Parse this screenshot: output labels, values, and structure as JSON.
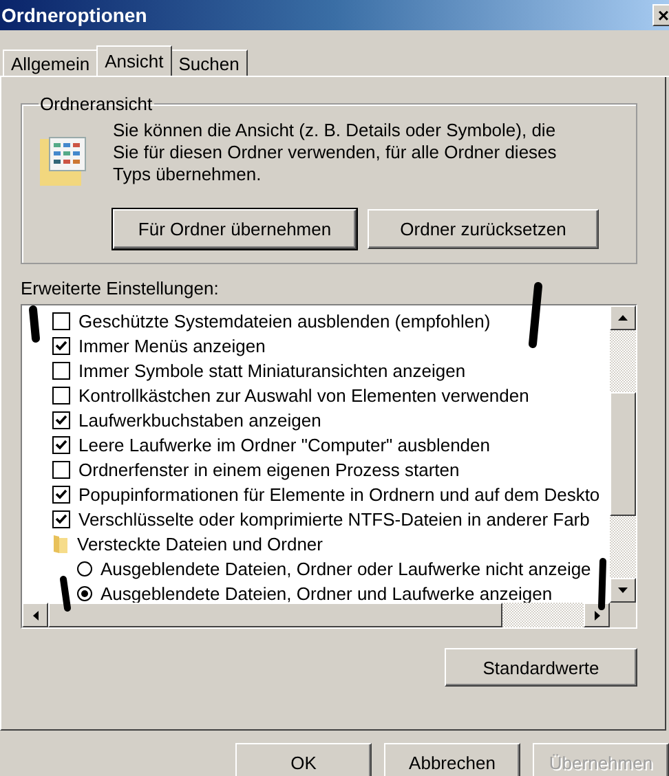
{
  "window": {
    "title": "Ordneroptionen",
    "close": "×"
  },
  "tabs": [
    {
      "label": "Allgemein",
      "selected": false
    },
    {
      "label": "Ansicht",
      "selected": true
    },
    {
      "label": "Suchen",
      "selected": false
    }
  ],
  "folder_view": {
    "title": "Ordneransicht",
    "description": "Sie können die Ansicht (z. B. Details oder Symbole), die Sie für diesen Ordner verwenden, für alle Ordner dieses Typs übernehmen.",
    "buttons": [
      {
        "label": "Für Ordner übernehmen",
        "default": true
      },
      {
        "label": "Ordner zurücksetzen",
        "default": false
      }
    ]
  },
  "advanced": {
    "label": "Erweiterte Einstellungen:",
    "items": [
      {
        "kind": "checkbox",
        "label": "Geschützte Systemdateien ausblenden (empfohlen)",
        "checked": false
      },
      {
        "kind": "checkbox",
        "label": "Immer Menüs anzeigen",
        "checked": true
      },
      {
        "kind": "checkbox",
        "label": "Immer Symbole statt Miniaturansichten anzeigen",
        "checked": false
      },
      {
        "kind": "checkbox",
        "label": "Kontrollkästchen zur Auswahl von Elementen verwenden",
        "checked": false
      },
      {
        "kind": "checkbox",
        "label": "Laufwerkbuchstaben anzeigen",
        "checked": true
      },
      {
        "kind": "checkbox",
        "label": "Leere Laufwerke im Ordner \"Computer\" ausblenden",
        "checked": true
      },
      {
        "kind": "checkbox",
        "label": "Ordnerfenster in einem eigenen Prozess starten",
        "checked": false
      },
      {
        "kind": "checkbox",
        "label": "Popupinformationen für Elemente in Ordnern und auf dem Deskto",
        "checked": true
      },
      {
        "kind": "checkbox",
        "label": "Verschlüsselte oder komprimierte NTFS-Dateien in anderer Farb",
        "checked": true
      },
      {
        "kind": "folder",
        "label": "Versteckte Dateien und Ordner",
        "children": [
          {
            "kind": "radio",
            "label": "Ausgeblendete Dateien, Ordner oder Laufwerke nicht anzeige",
            "selected": false
          },
          {
            "kind": "radio",
            "label": "Ausgeblendete Dateien, Ordner und Laufwerke anzeigen",
            "selected": true
          }
        ]
      }
    ],
    "defaults_button": "Standardwerte"
  },
  "buttons": [
    {
      "label": "OK",
      "disabled": false
    },
    {
      "label": "Abbrechen",
      "disabled": false
    },
    {
      "label": "Übernehmen",
      "disabled": true
    }
  ]
}
